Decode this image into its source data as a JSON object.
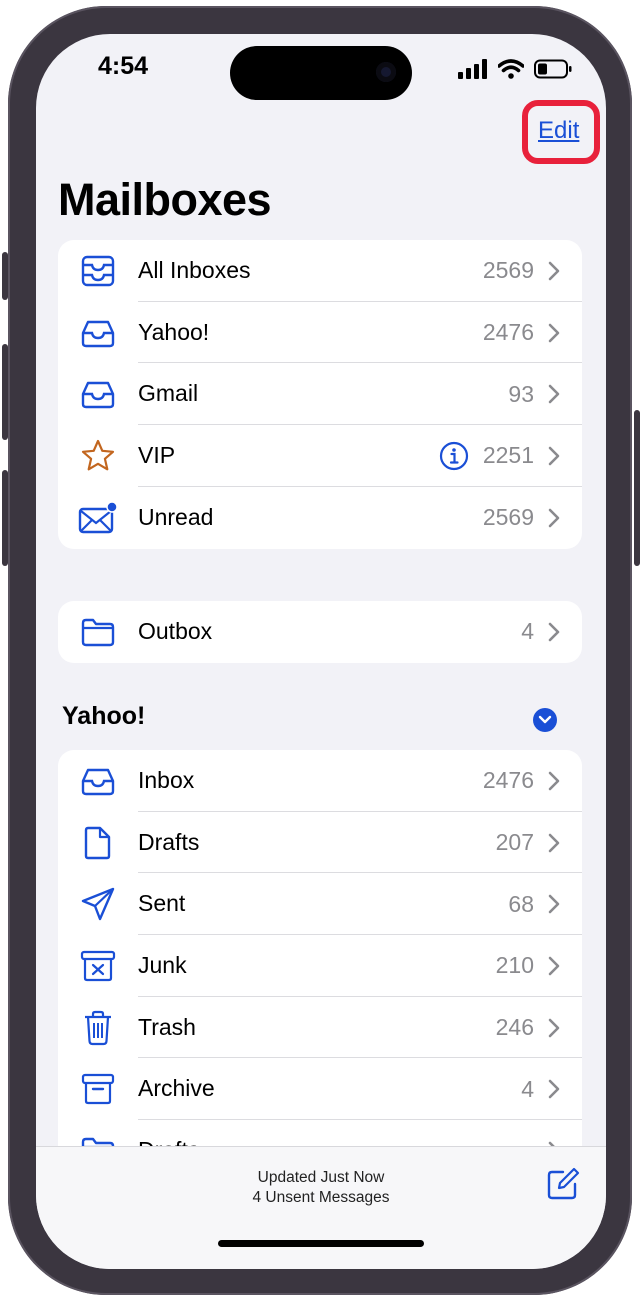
{
  "status_bar": {
    "time": "4:54"
  },
  "header": {
    "edit_label": "Edit",
    "title": "Mailboxes"
  },
  "mailboxes": [
    {
      "label": "All Inboxes",
      "count": "2569",
      "icon": "all-inboxes-icon"
    },
    {
      "label": "Yahoo!",
      "count": "2476",
      "icon": "inbox-tray-icon"
    },
    {
      "label": "Gmail",
      "count": "93",
      "icon": "inbox-tray-icon"
    },
    {
      "label": "VIP",
      "count": "2251",
      "icon": "star-icon"
    },
    {
      "label": "Unread",
      "count": "2569",
      "icon": "envelope-unread-icon"
    }
  ],
  "outbox": {
    "label": "Outbox",
    "count": "4",
    "icon": "folder-icon"
  },
  "account_section": {
    "title": "Yahoo!",
    "items": [
      {
        "label": "Inbox",
        "count": "2476",
        "icon": "inbox-tray-icon"
      },
      {
        "label": "Drafts",
        "count": "207",
        "icon": "document-icon"
      },
      {
        "label": "Sent",
        "count": "68",
        "icon": "paper-plane-icon"
      },
      {
        "label": "Junk",
        "count": "210",
        "icon": "junk-bin-icon"
      },
      {
        "label": "Trash",
        "count": "246",
        "icon": "trash-icon"
      },
      {
        "label": "Archive",
        "count": "4",
        "icon": "archive-box-icon"
      },
      {
        "label": "Drafts",
        "count": "",
        "icon": "folder-icon"
      }
    ]
  },
  "bottom_bar": {
    "status_line1": "Updated Just Now",
    "status_line2": "4 Unsent Messages"
  },
  "colors": {
    "accent": "#1a4fd6",
    "vip_star": "#c2661f",
    "highlight": "#e8213b",
    "background": "#f2f2f7"
  }
}
